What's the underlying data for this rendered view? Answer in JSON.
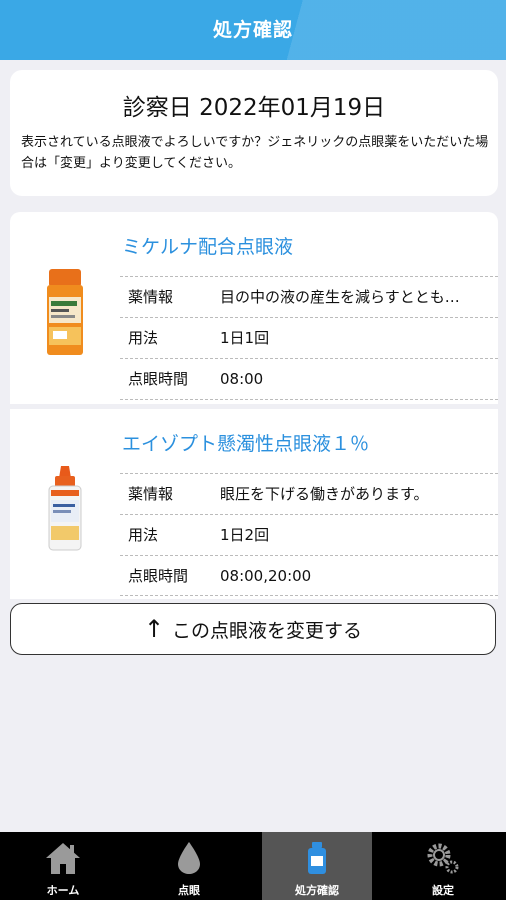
{
  "header": {
    "title": "処方確認"
  },
  "visit": {
    "date_label": "診察日 2022年01月19日",
    "message": "表示されている点眼液でよろしいですか？ジェネリックの点眼薬をいただいた場合は「変更」より変更してください。"
  },
  "medicines": [
    {
      "name": "ミケルナ配合点眼液",
      "info_label": "薬情報",
      "info": "目の中の液の産生を減らすととも…",
      "usage_label": "用法",
      "usage": "1日1回",
      "time_label": "点眼時間",
      "time": "08:00"
    },
    {
      "name": "エイゾプト懸濁性点眼液１％",
      "info_label": "薬情報",
      "info": "眼圧を下げる働きがあります。",
      "usage_label": "用法",
      "usage": "1日2回",
      "time_label": "点眼時間",
      "time": "08:00,20:00"
    }
  ],
  "change_button": {
    "arrow": "↑",
    "label": "この点眼液を変更する"
  },
  "tabs": [
    {
      "label": "ホーム",
      "icon": "home-icon"
    },
    {
      "label": "点眼",
      "icon": "drop-icon"
    },
    {
      "label": "処方確認",
      "icon": "bottle-icon",
      "active": true
    },
    {
      "label": "設定",
      "icon": "gear-icon"
    }
  ],
  "colors": {
    "header": "#3aa8e6",
    "accent": "#2b90de",
    "tabbar": "#000000",
    "active_tab": "#555555"
  }
}
